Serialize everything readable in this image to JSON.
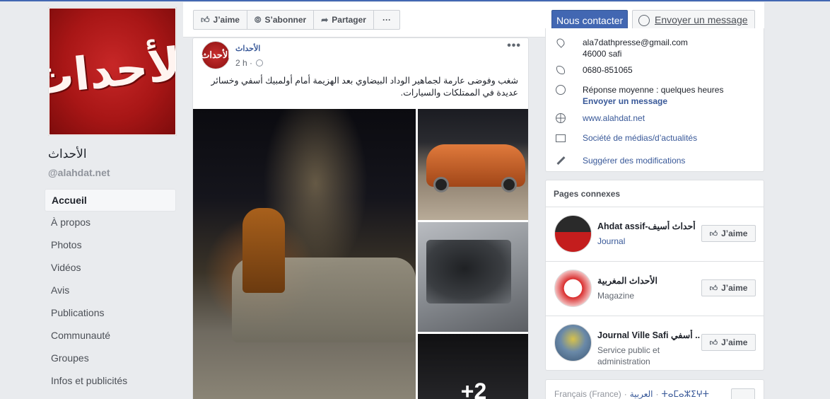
{
  "page": {
    "name": "الأحداث",
    "handle": "@alahdat.net",
    "logo_text": "الأحداث"
  },
  "nav": {
    "items": [
      {
        "label": "Accueil",
        "active": true
      },
      {
        "label": "À propos"
      },
      {
        "label": "Photos"
      },
      {
        "label": "Vidéos"
      },
      {
        "label": "Avis"
      },
      {
        "label": "Publications"
      },
      {
        "label": "Communauté"
      },
      {
        "label": "Groupes"
      },
      {
        "label": "Infos et publicités"
      }
    ]
  },
  "header": {
    "like_label": "J’aime",
    "subscribe_label": "S’abonner",
    "share_label": "Partager",
    "more_label": "···",
    "contact_label": "Nous contacter",
    "message_label": "Envoyer un message"
  },
  "post": {
    "author": "الأحداث",
    "time": "2 h ·",
    "more": "•••",
    "avatar_text": "الأحداث",
    "text": "شغب وفوضى عارمة لجماهير الوداد البيضاوي بعد الهزيمة أمام أولمبيك أسفي وخسائر عديدة في الممتلكات والسيارات.",
    "extra_photos": "+2"
  },
  "about": {
    "email": "ala7dathpresse@gmail.com",
    "postal": "46000 safi",
    "phone": "0680-851065",
    "response": "Réponse moyenne : quelques heures",
    "response_link": "Envoyer un message",
    "website": "www.alahdat.net",
    "category": "Société de médias/d’actualités",
    "suggest": "Suggérer des modifications"
  },
  "related": {
    "title": "Pages connexes",
    "like_label": "J’aime",
    "items": [
      {
        "name": "Ahdat assif-أحداث أسيف",
        "category": "Journal",
        "category_link": true
      },
      {
        "name": "الأحداث المغربية",
        "category": "Magazine",
        "category_link": false
      },
      {
        "name": "Journal Ville Safi أسفي ...",
        "category": "Service public et administration",
        "category_link": false
      }
    ]
  },
  "footer": {
    "lang_fr": "Français (France)",
    "lang_ar": "العربية",
    "lang_other": "ⵜⴰⵎⴰⵣⵉⵖⵜ"
  }
}
